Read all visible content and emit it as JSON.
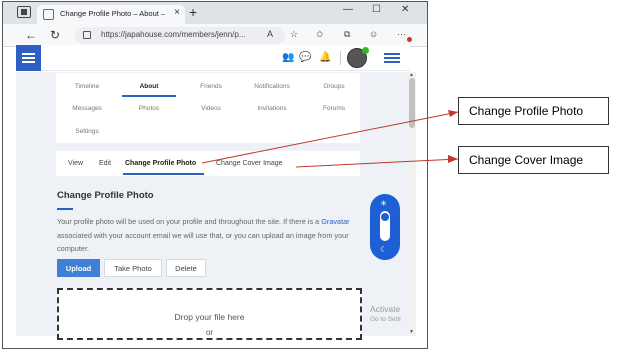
{
  "browser": {
    "tab_title": "Change Profile Photo – About –",
    "tab_close": "×",
    "new_tab": "+",
    "url": "https://japahouse.com/members/jenn/p...",
    "window_controls": [
      "—",
      "☐",
      "✕"
    ]
  },
  "profile_tabs": {
    "row1": [
      "Timeline",
      "About",
      "Friends",
      "Notifications",
      "Groups"
    ],
    "row2": [
      "Messages",
      "Photos",
      "Videos",
      "Invitations",
      "Forums"
    ],
    "row3": [
      "Settings"
    ],
    "active": "About"
  },
  "sub_tabs": {
    "items": [
      "View",
      "Edit",
      "Change Profile Photo",
      "Change Cover Image"
    ],
    "active": "Change Profile Photo"
  },
  "section": {
    "title": "Change Profile Photo",
    "desc_part1": "Your profile photo will be used on your profile and throughout the site. If there is a ",
    "desc_link": "Gravatar",
    "desc_part2": " associated with your account email we will use that, or you can upload an image from your computer."
  },
  "actions": {
    "upload": "Upload",
    "take_photo": "Take Photo",
    "delete": "Delete"
  },
  "dropzone": {
    "text": "Drop your file here",
    "or": "or"
  },
  "watermark": {
    "line1": "Activate",
    "line2": "Go to Setti"
  },
  "callouts": {
    "profile_photo": "Change Profile Photo",
    "cover_image": "Change Cover Image"
  },
  "colors": {
    "accent": "#2d5fc4",
    "primary_button": "#3f7fd6",
    "arrow": "#c0392b"
  }
}
